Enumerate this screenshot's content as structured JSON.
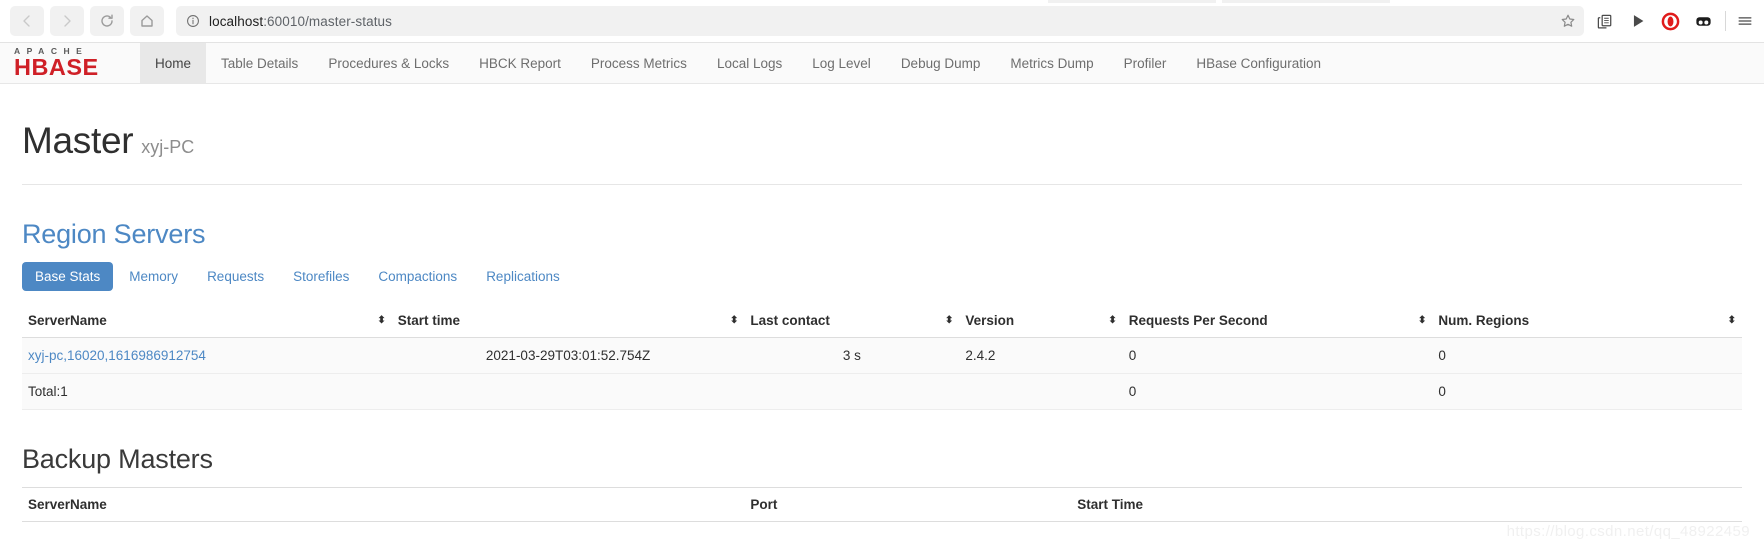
{
  "browser": {
    "back_label": "Back",
    "forward_label": "Forward",
    "reload_label": "Reload",
    "home_label": "Home",
    "url_host": "localhost",
    "url_path": ":60010/master-status",
    "url_full": "localhost:60010/master-status",
    "bookmark_label": "Bookmark this page",
    "extensions": [
      {
        "name": "copy-extension-icon",
        "title": "Copy"
      },
      {
        "name": "play-extension-icon",
        "title": "Play"
      },
      {
        "name": "opera-vpn-icon",
        "title": "VPN",
        "color": "#e01b1b"
      },
      {
        "name": "wallet-extension-icon",
        "title": "Wallet"
      }
    ],
    "menu_label": "Customize and control"
  },
  "navbar": {
    "brand_apache": "APACHE",
    "brand_hbase": "HBASE",
    "items": [
      {
        "label": "Home",
        "active": true
      },
      {
        "label": "Table Details",
        "active": false
      },
      {
        "label": "Procedures & Locks",
        "active": false
      },
      {
        "label": "HBCK Report",
        "active": false
      },
      {
        "label": "Process Metrics",
        "active": false
      },
      {
        "label": "Local Logs",
        "active": false
      },
      {
        "label": "Log Level",
        "active": false
      },
      {
        "label": "Debug Dump",
        "active": false
      },
      {
        "label": "Metrics Dump",
        "active": false
      },
      {
        "label": "Profiler",
        "active": false
      },
      {
        "label": "HBase Configuration",
        "active": false
      }
    ]
  },
  "master": {
    "title": "Master",
    "hostname": "xyj-PC"
  },
  "region_servers": {
    "title": "Region Servers",
    "tabs": [
      {
        "label": "Base Stats",
        "active": true
      },
      {
        "label": "Memory",
        "active": false
      },
      {
        "label": "Requests",
        "active": false
      },
      {
        "label": "Storefiles",
        "active": false
      },
      {
        "label": "Compactions",
        "active": false
      },
      {
        "label": "Replications",
        "active": false
      }
    ],
    "columns": [
      "ServerName",
      "Start time",
      "Last contact",
      "Version",
      "Requests Per Second",
      "Num. Regions"
    ],
    "rows": [
      {
        "server_name": "xyj-pc,16020,1616986912754",
        "start_time": "2021-03-29T03:01:52.754Z",
        "last_contact": "3 s",
        "version": "2.4.2",
        "requests_per_second": "0",
        "num_regions": "0"
      }
    ],
    "total": {
      "label": "Total:1",
      "start_time": "",
      "last_contact": "",
      "version": "",
      "requests_per_second": "0",
      "num_regions": "0"
    }
  },
  "backup_masters": {
    "title": "Backup Masters",
    "columns": [
      "ServerName",
      "Port",
      "Start Time"
    ]
  },
  "watermark": "https://blog.csdn.net/qq_48922459",
  "colors": {
    "accent_blue": "#4d88c4",
    "brand_red": "#cf2027",
    "opera_red": "#e01b1b"
  }
}
